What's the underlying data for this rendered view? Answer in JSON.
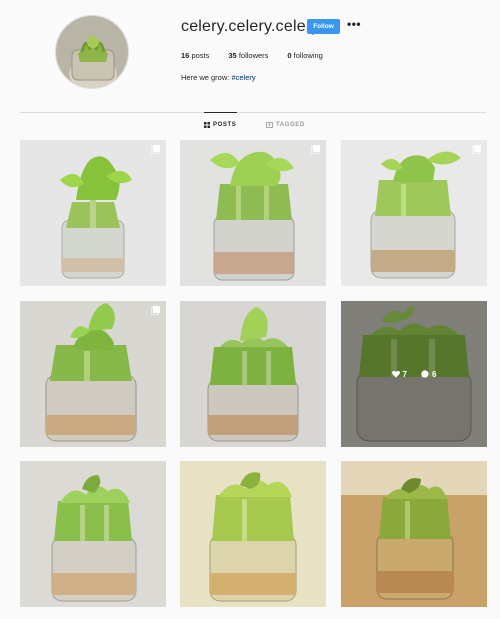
{
  "profile": {
    "username": "celery.celery.celery",
    "follow_label": "Follow",
    "more_glyph": "•••",
    "stats": {
      "posts_count": "16",
      "posts_label": "posts",
      "followers_count": "35",
      "followers_label": "followers",
      "following_count": "0",
      "following_label": "following"
    },
    "bio_text": "Here we grow: ",
    "bio_hashtag": "#celery"
  },
  "tabs": {
    "posts_label": "POSTS",
    "tagged_label": "TAGGED"
  },
  "hover_overlay": {
    "likes": "7",
    "comments": "6"
  },
  "colors": {
    "accent": "#3897f0",
    "hashtag": "#003569",
    "background": "#fafafa"
  }
}
